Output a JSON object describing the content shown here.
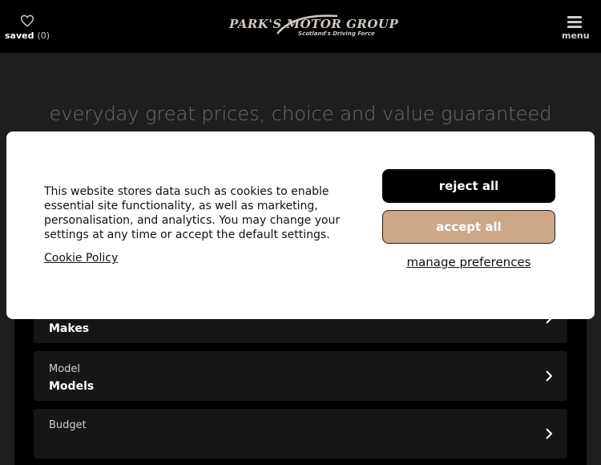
{
  "header": {
    "saved_label": "saved",
    "saved_count": "(0)",
    "logo_title": "PARK'S MOTOR GROUP",
    "logo_tagline": "Scotland's Driving Force",
    "menu_label": "menu"
  },
  "hero": {
    "headline": "everyday great prices, choice and value guaranteed"
  },
  "search": {
    "rows": [
      {
        "label": "",
        "value": "Makes"
      },
      {
        "label": "Model",
        "value": "Models"
      },
      {
        "label": "Budget",
        "value": ""
      }
    ]
  },
  "cookie_modal": {
    "message": "This website stores data such as cookies to enable essential site functionality, as well as marketing, personalisation, and analytics. You may change your settings at any time or accept the default settings.",
    "policy_link": "Cookie Policy",
    "reject_label": "reject all",
    "accept_label": "accept all",
    "manage_label": "manage preferences"
  },
  "colors": {
    "accent": "#cca888",
    "topbar": "#000000",
    "background": "#1e1e1e"
  }
}
